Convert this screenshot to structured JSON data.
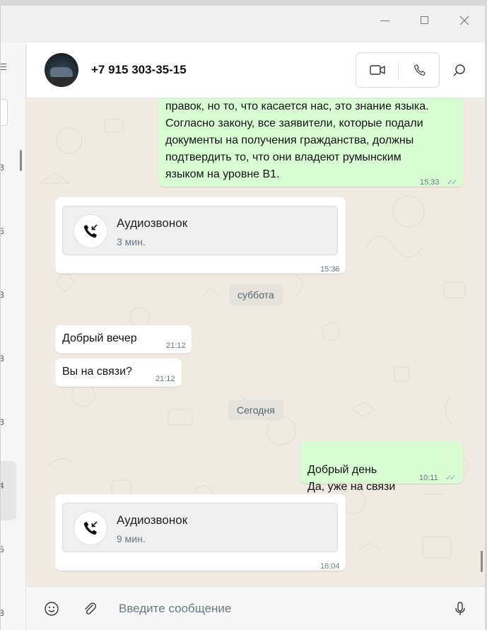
{
  "window": {
    "controls": [
      "minimize",
      "maximize",
      "close"
    ]
  },
  "sidebar": {
    "fragments": [
      "3",
      "5",
      "3",
      "3",
      "3",
      "4",
      "5",
      "3"
    ]
  },
  "header": {
    "contact_name": "+7 915 303-35-15",
    "video_icon": "video-camera-icon",
    "voice_icon": "phone-icon",
    "search_icon": "search-icon"
  },
  "messages": [
    {
      "direction": "out",
      "text": "правок, но то, что касается нас, это знание языка.\nСогласно закону, все заявители, которые подали\nдокументы на получения гражданства, должны\nподтвердить то, что они владеют румынским\nязыком на уровне В1.",
      "time": "15:33",
      "read": true
    },
    {
      "direction": "in",
      "type": "call",
      "title": "Аудиозвонок",
      "duration": "3 мин.",
      "time": "15:36"
    },
    {
      "type": "day",
      "label": "суббота"
    },
    {
      "direction": "in",
      "text": "Добрый вечер",
      "time": "21:12"
    },
    {
      "direction": "in",
      "text": "Вы на связи?",
      "time": "21:12"
    },
    {
      "type": "day",
      "label": "Сегодня"
    },
    {
      "direction": "out",
      "text": "Добрый день\nДа, уже на связи",
      "time": "10:11",
      "read": true
    },
    {
      "direction": "in",
      "type": "call",
      "title": "Аудиозвонок",
      "duration": "9 мин.",
      "time": "16:04"
    }
  ],
  "composer": {
    "placeholder": "Введите сообщение",
    "emoji_icon": "emoji-icon",
    "attach_icon": "paperclip-icon",
    "mic_icon": "microphone-icon"
  },
  "colors": {
    "outgoing_bubble": "#d9fdd3",
    "incoming_bubble": "#ffffff",
    "chat_background": "#efeae2"
  }
}
